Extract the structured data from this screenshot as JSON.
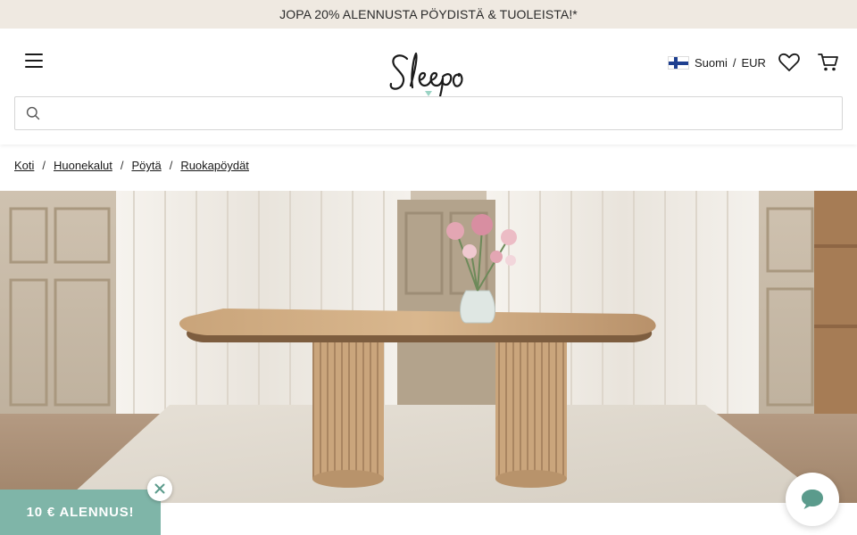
{
  "promo_banner": {
    "text": "JOPA 20% ALENNUSTA PÖYDISTÄ & TUOLEISTA!*"
  },
  "header": {
    "logo_text": "Sleepo",
    "locale": {
      "language": "Suomi",
      "separator": "/",
      "currency": "EUR",
      "flag": "finland-flag"
    },
    "icons": [
      "menu-icon",
      "heart-icon",
      "cart-icon",
      "search-icon"
    ]
  },
  "search": {
    "value": "",
    "placeholder": ""
  },
  "breadcrumb": {
    "items": [
      {
        "label": "Koti"
      },
      {
        "label": "Huonekalut"
      },
      {
        "label": "Pöytä"
      },
      {
        "label": "Ruokapöydät"
      }
    ],
    "separator": "/"
  },
  "hero": {
    "description_icon": "dining-table-photo"
  },
  "discount_popup": {
    "label": "10 € ALENNUS!"
  },
  "colors": {
    "promo_bg": "#efe9e1",
    "discount_bg": "#7fb5a8",
    "chat_icon": "#5b9b8c",
    "logo_accent": "#9bd3c4"
  }
}
